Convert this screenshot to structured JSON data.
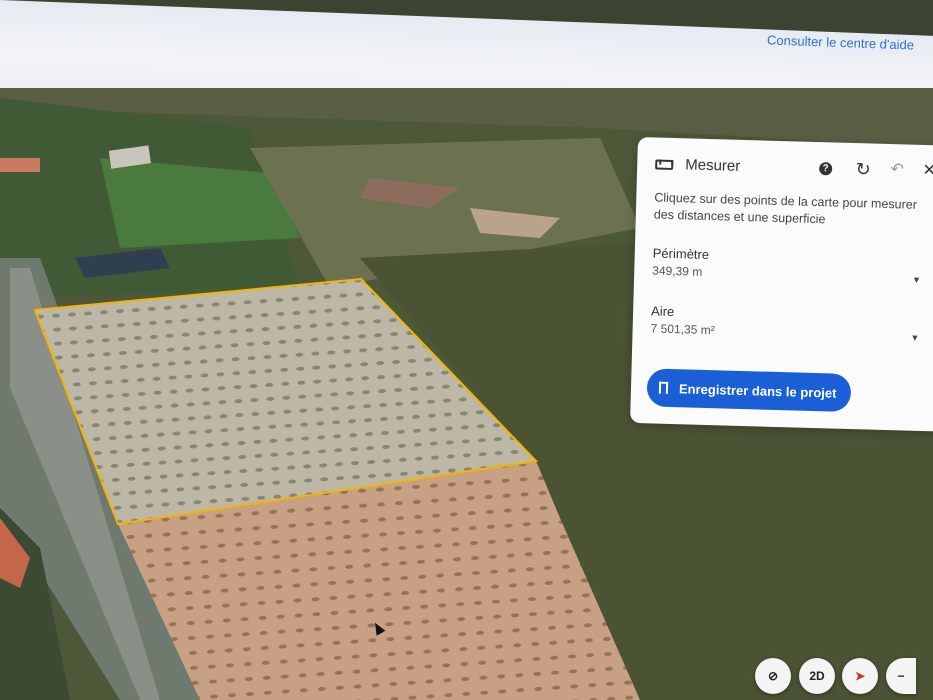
{
  "header": {
    "help_link": "Consulter le centre d'aide",
    "brand_icon": "app-logo-icon"
  },
  "measure_panel": {
    "title": "Mesurer",
    "icons": [
      "ruler-icon",
      "help-icon",
      "refresh-icon",
      "undo-icon",
      "close-icon"
    ],
    "description": "Cliquez sur des points de la carte pour mesurer des distances et une superficie",
    "perimeter": {
      "label": "Périmètre",
      "value": "349,39 m"
    },
    "area": {
      "label": "Aire",
      "value": "7 501,35 m²"
    },
    "save_button": "Enregistrer dans le projet",
    "accent_color": "#1a5fd6"
  },
  "map_controls": {
    "view_mode": "2D",
    "icons": [
      "tilt-icon",
      "compass-icon",
      "zoom-out-icon"
    ]
  },
  "measurement_outline_color": "#f5b400"
}
